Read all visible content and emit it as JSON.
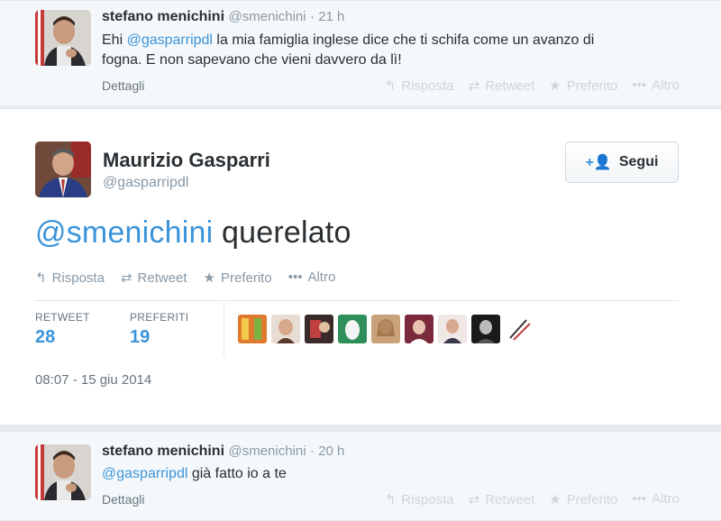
{
  "top_tweet": {
    "name": "stefano menichini",
    "handle": "@smenichini",
    "time": "· 21 h",
    "mention": "@gasparripdl",
    "text_line1": " la mia famiglia inglese dice che ti schifa come un avanzo di",
    "text_line2": "fogna. E non sapevano che vieni davvero da lì!",
    "text_prefix": "Ehi ",
    "details": "Dettagli",
    "actions": {
      "reply": "Risposta",
      "retweet": "Retweet",
      "favorite": "Preferito",
      "more": "Altro"
    }
  },
  "main_tweet": {
    "name": "Maurizio Gasparri",
    "handle": "@gasparripdl",
    "follow_label": "Segui",
    "mention": "@smenichini",
    "text": " querelato",
    "actions": {
      "reply": "Risposta",
      "retweet": "Retweet",
      "favorite": "Preferito",
      "more": "Altro"
    },
    "stats": {
      "retweet_label": "RETWEET",
      "retweet_count": "28",
      "fav_label": "PREFERITI",
      "fav_count": "19"
    },
    "timestamp": "08:07 - 15 giu 2014"
  },
  "bottom_tweet": {
    "name": "stefano menichini",
    "handle": "@smenichini",
    "time": "· 20 h",
    "mention": "@gasparripdl",
    "text": " già fatto io a te",
    "details": "Dettagli",
    "actions": {
      "reply": "Risposta",
      "retweet": "Retweet",
      "favorite": "Preferito",
      "more": "Altro"
    }
  },
  "colors": {
    "link": "#3b94d9",
    "muted": "#8899a6",
    "faded": "#ccd6dd"
  },
  "icons": [
    "reply-icon",
    "retweet-icon",
    "favorite-icon",
    "more-icon",
    "follow-user-icon"
  ]
}
